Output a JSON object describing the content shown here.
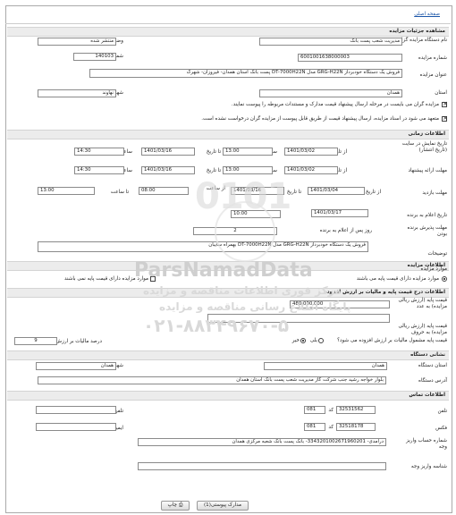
{
  "top_link": "صفحه اصلی",
  "sections": {
    "details": "مشاهده جزئیات مزایده",
    "time": "اطلاعات زمانی",
    "auction": "اطلاعات مزایده",
    "price": "اطلاعات درج قیمت پایه و مالیات بر ارزش افزوده",
    "address": "نشانی دستگاه",
    "contact": "اطلاعات تماس"
  },
  "details": {
    "org_label": "نام دستگاه مزایده گزار",
    "org_value": "مدیریت شعب پست بانک",
    "status_label": "وضعیت مزایده",
    "status_value": "منتشر شده",
    "number_label": "شماره مزایده",
    "number_value": "6001001638000003",
    "ref_label": "شماره مزایده مرجع",
    "ref_value": "140103",
    "title_label": "عنوان مزایده",
    "title_value": "فروش یک دستگاه خودبرداز GRG-H22N مدل DT-7000H22N پست بانک استان همدان- فیروزان- شهرک",
    "province_label": "استان",
    "province_value": "همدان",
    "city_label": "شهر",
    "city_value": "نهاوند",
    "note1": "مزایده گران می بایست در مرحله ارسال پیشنهاد قیمت مدارک و مستندات مربوطه را پیوست نمایند.",
    "note2": "متعهد می شود در اسناد مزایده، ارسال پیشنهاد قیمت از طریق قابل پیوست از مزایده گران درخواست نشده است."
  },
  "time": {
    "visit_label": "تاریخ نمایش در سایت (تاریخ انتشار)",
    "offer_label": "مهلت ارائه پیشنهاد",
    "inspect_label": "مهلت بازدید",
    "announce_label": "تاریخ اعلام به برنده",
    "accept_label": "مهلت پذیرش برنده بودن",
    "from": "از تاریخ",
    "to": "تا تاریخ",
    "hour": "ساعت",
    "from_hour": "از ساعت",
    "to_hour": "تا ساعت",
    "visit_from_date": "1401/03/02",
    "visit_from_time": "13:00",
    "visit_to_date": "1401/03/16",
    "visit_to_time": "14:30",
    "offer_from_date": "1401/03/02",
    "offer_from_time": "13:00",
    "offer_to_date": "1401/03/16",
    "offer_to_time": "14:30",
    "inspect_from_date": "1401/03/04",
    "inspect_to_date": "1401/03/16",
    "inspect_from_time": "08:00",
    "inspect_to_time": "13:00",
    "announce_date": "1401/03/17",
    "announce_time": "10:00",
    "accept_days": "2",
    "accept_suffix": "روز پس از اعلام به برنده"
  },
  "auction": {
    "desc_label": "توضیحات",
    "desc_value": "فروش یک دستگاه خودبرداز GRG-H22N مدل DT-7000H22N بهمراه سایبان",
    "type_label": "موارد مزایده",
    "opt_yes": "موارد مزایده دارای قیمت پایه می باشند",
    "opt_no": "موارد مزایده دارای قیمت پایه نمی باشند"
  },
  "price": {
    "base_num_label": "قیمت پایه (ارزش ریالی مزایده) به عدد",
    "base_num_value": "480,000,000",
    "base_txt_label": "قیمت پایه (ارزش ریالی مزایده) به حروف",
    "base_txt_value": "",
    "vat_q_label": "قیمت پایه مشمول مالیات بر ارزش افزوده می شود؟",
    "yes": "بلی",
    "no": "خیر",
    "vat_pct_label": "درصد مالیات بر ارزش افزوده",
    "vat_pct_value": "9"
  },
  "address": {
    "prov_label": "استان دستگاه",
    "prov_value": "همدان",
    "city_label": "شهر دستگاه",
    "city_value": "همدان",
    "addr_label": "آدرس دستگاه",
    "addr_value": "بلوار خواجه رشید جنب شرکت گاز مدیریت شعب پست بانک استان همدان"
  },
  "contact": {
    "phone_label": "تلفن",
    "phone_code": "081",
    "phone_value": "32531562",
    "mobile_label": "تلفن همراه",
    "fax_label": "فکس",
    "fax_code": "081",
    "fax_value": "32518178",
    "email_label": "ایمیل",
    "code_label": "کد",
    "account_label": "شماره حساب واریز وجه",
    "account_value": "درآمدی- 3343201002671960201- بانک پست بانک شعبه مرکزی همدان",
    "shaba_label": "شناسه واریز وجه",
    "shaba_value": ""
  },
  "footer": {
    "attach_button": "مدارک پیوستی(1)",
    "print_button": "چاپ"
  },
  "watermark": {
    "brand": "ParsNamadData",
    "line1": "مرکز فوری اطلاعات مناقصه و مزایده",
    "line2": "پایگاه اطلاع رسانی مناقصه و مزایده",
    "phone": "۰۲۱-۸۸۳۴۹۶۷۰-۵"
  }
}
